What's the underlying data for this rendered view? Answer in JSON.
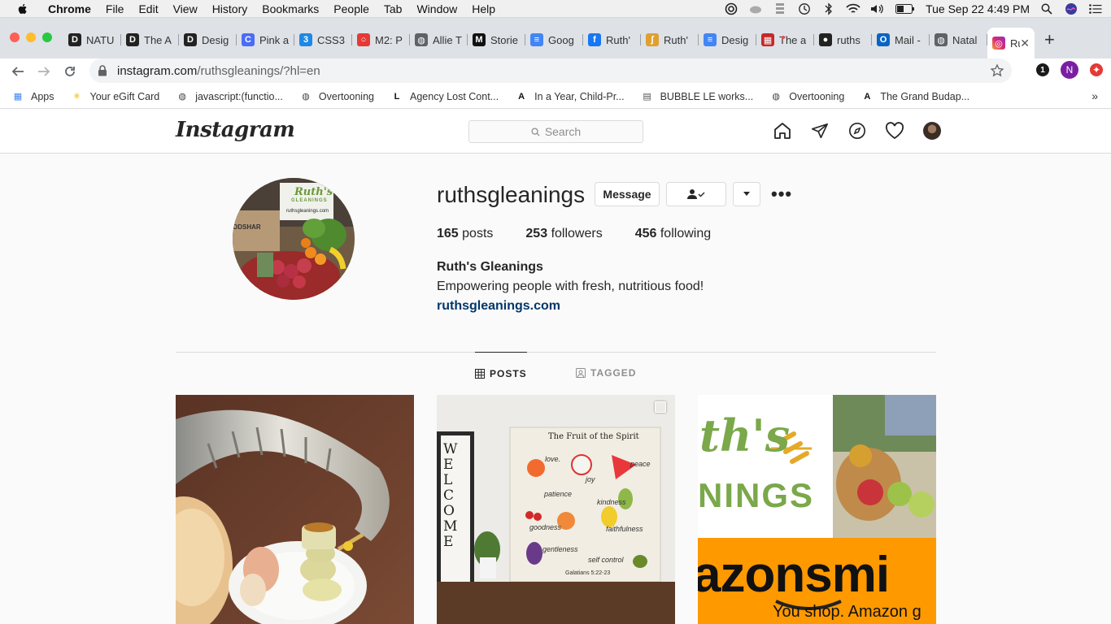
{
  "menubar": {
    "app": "Chrome",
    "items": [
      "File",
      "Edit",
      "View",
      "History",
      "Bookmarks",
      "People",
      "Tab",
      "Window",
      "Help"
    ],
    "clock": "Tue Sep 22  4:49 PM"
  },
  "tabs": [
    {
      "label": "NATU",
      "icon": "d-icon",
      "color": "#222"
    },
    {
      "label": "The A",
      "icon": "d-icon",
      "color": "#222"
    },
    {
      "label": "Desig",
      "icon": "d-icon",
      "color": "#222"
    },
    {
      "label": "Pink a",
      "icon": "c-icon",
      "color": "#4a6cf7"
    },
    {
      "label": "CSS3",
      "icon": "css-icon",
      "color": "#1e88e5"
    },
    {
      "label": "M2: P",
      "icon": "ring-icon",
      "color": "#e53935"
    },
    {
      "label": "Allie T",
      "icon": "globe-icon",
      "color": "#5f6368"
    },
    {
      "label": "Storie",
      "icon": "medium-icon",
      "color": "#111"
    },
    {
      "label": "Goog",
      "icon": "docs-icon",
      "color": "#4285f4"
    },
    {
      "label": "Ruth'",
      "icon": "facebook-icon",
      "color": "#1877f2"
    },
    {
      "label": "Ruth'",
      "icon": "wheat-icon",
      "color": "#e0a030"
    },
    {
      "label": "Desig",
      "icon": "docs-icon",
      "color": "#4285f4"
    },
    {
      "label": "The a",
      "icon": "grid-icon",
      "color": "#c62828"
    },
    {
      "label": "ruths",
      "icon": "github-icon",
      "color": "#222"
    },
    {
      "label": "Mail -",
      "icon": "outlook-icon",
      "color": "#0a64c4"
    },
    {
      "label": "Natal",
      "icon": "globe-icon",
      "color": "#5f6368"
    }
  ],
  "active_tab": {
    "label": "Ru",
    "icon": "instagram-icon",
    "close": "✕"
  },
  "new_tab": "+",
  "omnibox": {
    "host": "instagram.com",
    "path": "/ruthsgleanings/?hl=en"
  },
  "profile_initial": "N",
  "extension_badge": "1",
  "bookmarks": [
    {
      "label": "Apps",
      "icon": "apps-icon"
    },
    {
      "label": "Your eGift Card",
      "icon": "walmart-icon"
    },
    {
      "label": "javascript:(functio...",
      "icon": "globe-icon"
    },
    {
      "label": "Overtooning",
      "icon": "globe-icon"
    },
    {
      "label": "Agency Lost Cont...",
      "icon": "l-icon"
    },
    {
      "label": "In a Year, Child-Pr...",
      "icon": "a-icon"
    },
    {
      "label": "BUBBLE LE works...",
      "icon": "doc-icon"
    },
    {
      "label": "Overtooning",
      "icon": "globe-icon"
    },
    {
      "label": "The Grand Budap...",
      "icon": "a-icon"
    }
  ],
  "bookmarks_more": "»",
  "instagram": {
    "logo": "Instagram",
    "search_placeholder": "Search"
  },
  "profile": {
    "username": "ruthsgleanings",
    "message_button": "Message",
    "posts_count": "165",
    "posts_label": "posts",
    "followers_count": "253",
    "followers_label": "followers",
    "following_count": "456",
    "following_label": "following",
    "full_name": "Ruth's Gleanings",
    "bio": "Empowering people with fresh, nutritious food!",
    "website": "ruthsgleanings.com",
    "pic_sign_line1": "Ruth's",
    "pic_sign_line2": "GLEANINGS",
    "pic_sign_url": "ruthsgleanings.com",
    "pic_side_text": "ODSHAR"
  },
  "profile_tabs": {
    "posts": "POSTS",
    "tagged": "TAGGED"
  },
  "posts": [
    {
      "kind": "photo"
    },
    {
      "kind": "photo",
      "sign_title": "The Fruit of the Spirit",
      "words": [
        "love.",
        "joy",
        "peace",
        "patience",
        "kindness",
        "goodness",
        "faithfulness",
        "gentleness",
        "self control"
      ],
      "ref": "Galatians 5:22-23",
      "welcome": "WELCOME"
    },
    {
      "kind": "graphic",
      "brand_top": "th's",
      "brand_mid": "NINGS",
      "amazon": "azonsmi",
      "tagline": "You shop. Amazon g"
    }
  ],
  "colors": {
    "link": "#00376b",
    "accent_dot": "#ed4956"
  }
}
